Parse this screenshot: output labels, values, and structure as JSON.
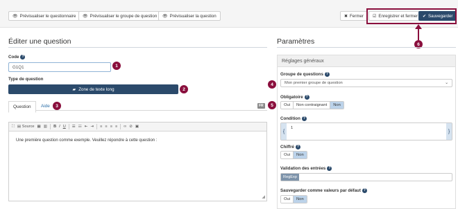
{
  "toolbar": {
    "preview_survey": "Prévisualiser le questionnaire",
    "preview_group": "Prévisualiser le groupe de question",
    "preview_question": "Prévisualiser la question",
    "close": "Fermer",
    "save_close": "Enregistrer et fermer",
    "save": "Sauvegarder"
  },
  "editor": {
    "title": "Éditer une question",
    "code_label": "Code",
    "code_value": "G1Q1",
    "type_label": "Type de question",
    "type_value": "Zone de texte long",
    "tabs": [
      "Question",
      "Aide"
    ],
    "lang": "FR",
    "toolbar_source": "Source",
    "body_text": "Une première question comme exemple. Veuillez répondre à cette question :"
  },
  "params": {
    "title": "Paramètres",
    "panel_title": "Réglages généraux",
    "group_label": "Groupe de questions",
    "group_value": "Mon premier groupe de question",
    "mandatory_label": "Obligatoire",
    "mandatory_options": [
      "Oui",
      "Non contraignant",
      "Non"
    ],
    "condition_label": "Condition",
    "condition_value": "1",
    "encrypted_label": "Chiffré",
    "encrypted_options": [
      "Oui",
      "Non"
    ],
    "validation_label": "Validation des entrées",
    "validation_tag": "RegExp",
    "save_default_label": "Sauvegarder comme valeurs par défaut",
    "save_default_options": [
      "Oui",
      "Non"
    ]
  },
  "annotations": [
    "1",
    "2",
    "3",
    "4",
    "5",
    "6"
  ],
  "colors": {
    "primary": "#2b4a6b",
    "annotation": "#8a0f3d",
    "selected": "#bcd3ea"
  }
}
